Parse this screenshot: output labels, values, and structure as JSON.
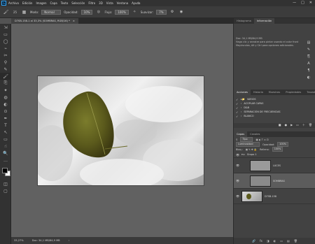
{
  "menubar": {
    "logo": "Ps",
    "items": [
      "Archivo",
      "Edición",
      "Imagen",
      "Capa",
      "Texto",
      "Selección",
      "Filtro",
      "3D",
      "Vista",
      "Ventana",
      "Ayuda"
    ],
    "controls": [
      "—",
      "□",
      "✕"
    ]
  },
  "options": {
    "brush_size": "25",
    "mode_label": "Modo:",
    "mode_value": "Normal",
    "opacity_label": "Opacidad:",
    "opacity_value": "10%",
    "flow_label": "Flujo:",
    "flow_value": "100%",
    "smooth_label": "Suavizar:",
    "smooth_value": "7%"
  },
  "document": {
    "tab_title": "D7SB-158-1 al 33,3% (SOMBRAS, RGB/16) *",
    "close": "×"
  },
  "status": {
    "zoom": "33,27%",
    "doc": "Doc: 34,1 MB/84,9 MB",
    "arrow": "›"
  },
  "panels": {
    "top_tabs": [
      "Histograma",
      "Información"
    ],
    "info_lines": [
      "Doc: 34,1 MB/84,9 MB",
      "Haga clic y arrastre para pintar usando el color frontal.",
      "Mayúsculas, Alt y Ctrl para opciones adicionales."
    ],
    "mid_tabs": [
      "Acciones",
      "Historia",
      "Muestras",
      "Propiedades",
      "Trazados"
    ],
    "action_steps": [
      {
        "check": "✓",
        "label": "VARIOS"
      },
      {
        "check": "✓",
        "label": "ACOPLAR CAPAS"
      },
      {
        "check": "✓",
        "label": "D&B"
      },
      {
        "check": "✓",
        "label": "SEPARACIÓN DE FRECUENCIAS"
      },
      {
        "check": "✓",
        "label": "BLANCO"
      }
    ],
    "layer_tabs": [
      "Capas",
      "Canales"
    ],
    "kind_label": "Tipo",
    "blend_value": "Luminosidad",
    "opacity_label": "Opacidad:",
    "opacity_value": "100%",
    "lock_label": "Bloq.:",
    "fill_label": "Relleno:",
    "fill_value": "100%",
    "layers": [
      {
        "name": "Grupo 1",
        "eye": "👁"
      },
      {
        "name": "LUCES",
        "eye": "👁"
      },
      {
        "name": "SOMBRAS",
        "eye": "👁"
      },
      {
        "name": "D7SB-158",
        "eye": "👁"
      }
    ],
    "footer_icons": [
      "🔗",
      "fx",
      "◨",
      "◐",
      "▭",
      "▤",
      "🗑"
    ]
  },
  "tools": [
    "⇲",
    "▭",
    "◯",
    "⌁",
    "✂",
    "⚲",
    "✎",
    "🖌",
    "⎘",
    "✦",
    "◍",
    "◐",
    "⊙",
    "✒",
    "T",
    "↖",
    "▭",
    "☝",
    "🔍",
    "…"
  ],
  "colors": {
    "accent": "#31a8ff",
    "bg": "#535353"
  }
}
